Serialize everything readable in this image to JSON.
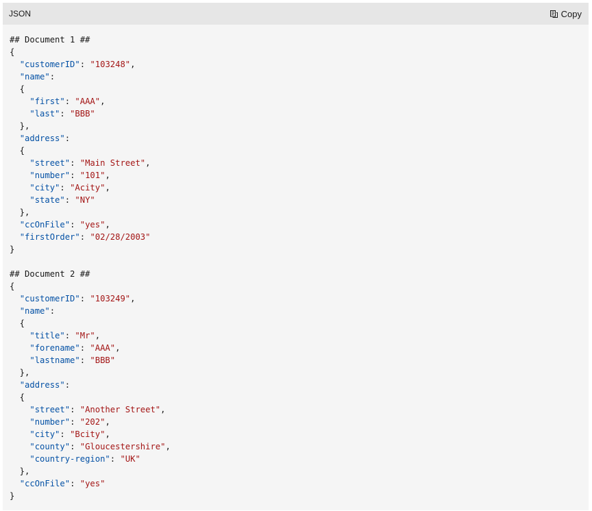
{
  "header": {
    "language": "JSON",
    "copy_label": "Copy",
    "copy_icon": "copy-icon"
  },
  "colors": {
    "key": "#0451a5",
    "string": "#a31515",
    "text": "#171717",
    "header_bg": "#e6e6e6",
    "body_bg": "#f5f5f5"
  },
  "code_lines": [
    [
      [
        "c",
        "## Document 1 ##"
      ]
    ],
    [
      [
        "p",
        "{"
      ]
    ],
    [
      [
        "p",
        "  "
      ],
      [
        "k",
        "\"customerID\""
      ],
      [
        "p",
        ": "
      ],
      [
        "s",
        "\"103248\""
      ],
      [
        "p",
        ","
      ]
    ],
    [
      [
        "p",
        "  "
      ],
      [
        "k",
        "\"name\""
      ],
      [
        "p",
        ":"
      ]
    ],
    [
      [
        "p",
        "  {"
      ]
    ],
    [
      [
        "p",
        "    "
      ],
      [
        "k",
        "\"first\""
      ],
      [
        "p",
        ": "
      ],
      [
        "s",
        "\"AAA\""
      ],
      [
        "p",
        ","
      ]
    ],
    [
      [
        "p",
        "    "
      ],
      [
        "k",
        "\"last\""
      ],
      [
        "p",
        ": "
      ],
      [
        "s",
        "\"BBB\""
      ]
    ],
    [
      [
        "p",
        "  },"
      ]
    ],
    [
      [
        "p",
        "  "
      ],
      [
        "k",
        "\"address\""
      ],
      [
        "p",
        ":"
      ]
    ],
    [
      [
        "p",
        "  {"
      ]
    ],
    [
      [
        "p",
        "    "
      ],
      [
        "k",
        "\"street\""
      ],
      [
        "p",
        ": "
      ],
      [
        "s",
        "\"Main Street\""
      ],
      [
        "p",
        ","
      ]
    ],
    [
      [
        "p",
        "    "
      ],
      [
        "k",
        "\"number\""
      ],
      [
        "p",
        ": "
      ],
      [
        "s",
        "\"101\""
      ],
      [
        "p",
        ","
      ]
    ],
    [
      [
        "p",
        "    "
      ],
      [
        "k",
        "\"city\""
      ],
      [
        "p",
        ": "
      ],
      [
        "s",
        "\"Acity\""
      ],
      [
        "p",
        ","
      ]
    ],
    [
      [
        "p",
        "    "
      ],
      [
        "k",
        "\"state\""
      ],
      [
        "p",
        ": "
      ],
      [
        "s",
        "\"NY\""
      ]
    ],
    [
      [
        "p",
        "  },"
      ]
    ],
    [
      [
        "p",
        "  "
      ],
      [
        "k",
        "\"ccOnFile\""
      ],
      [
        "p",
        ": "
      ],
      [
        "s",
        "\"yes\""
      ],
      [
        "p",
        ","
      ]
    ],
    [
      [
        "p",
        "  "
      ],
      [
        "k",
        "\"firstOrder\""
      ],
      [
        "p",
        ": "
      ],
      [
        "s",
        "\"02/28/2003\""
      ]
    ],
    [
      [
        "p",
        "}"
      ]
    ],
    [
      [
        "p",
        ""
      ]
    ],
    [
      [
        "c",
        "## Document 2 ##"
      ]
    ],
    [
      [
        "p",
        "{"
      ]
    ],
    [
      [
        "p",
        "  "
      ],
      [
        "k",
        "\"customerID\""
      ],
      [
        "p",
        ": "
      ],
      [
        "s",
        "\"103249\""
      ],
      [
        "p",
        ","
      ]
    ],
    [
      [
        "p",
        "  "
      ],
      [
        "k",
        "\"name\""
      ],
      [
        "p",
        ":"
      ]
    ],
    [
      [
        "p",
        "  {"
      ]
    ],
    [
      [
        "p",
        "    "
      ],
      [
        "k",
        "\"title\""
      ],
      [
        "p",
        ": "
      ],
      [
        "s",
        "\"Mr\""
      ],
      [
        "p",
        ","
      ]
    ],
    [
      [
        "p",
        "    "
      ],
      [
        "k",
        "\"forename\""
      ],
      [
        "p",
        ": "
      ],
      [
        "s",
        "\"AAA\""
      ],
      [
        "p",
        ","
      ]
    ],
    [
      [
        "p",
        "    "
      ],
      [
        "k",
        "\"lastname\""
      ],
      [
        "p",
        ": "
      ],
      [
        "s",
        "\"BBB\""
      ]
    ],
    [
      [
        "p",
        "  },"
      ]
    ],
    [
      [
        "p",
        "  "
      ],
      [
        "k",
        "\"address\""
      ],
      [
        "p",
        ":"
      ]
    ],
    [
      [
        "p",
        "  {"
      ]
    ],
    [
      [
        "p",
        "    "
      ],
      [
        "k",
        "\"street\""
      ],
      [
        "p",
        ": "
      ],
      [
        "s",
        "\"Another Street\""
      ],
      [
        "p",
        ","
      ]
    ],
    [
      [
        "p",
        "    "
      ],
      [
        "k",
        "\"number\""
      ],
      [
        "p",
        ": "
      ],
      [
        "s",
        "\"202\""
      ],
      [
        "p",
        ","
      ]
    ],
    [
      [
        "p",
        "    "
      ],
      [
        "k",
        "\"city\""
      ],
      [
        "p",
        ": "
      ],
      [
        "s",
        "\"Bcity\""
      ],
      [
        "p",
        ","
      ]
    ],
    [
      [
        "p",
        "    "
      ],
      [
        "k",
        "\"county\""
      ],
      [
        "p",
        ": "
      ],
      [
        "s",
        "\"Gloucestershire\""
      ],
      [
        "p",
        ","
      ]
    ],
    [
      [
        "p",
        "    "
      ],
      [
        "k",
        "\"country-region\""
      ],
      [
        "p",
        ": "
      ],
      [
        "s",
        "\"UK\""
      ]
    ],
    [
      [
        "p",
        "  },"
      ]
    ],
    [
      [
        "p",
        "  "
      ],
      [
        "k",
        "\"ccOnFile\""
      ],
      [
        "p",
        ": "
      ],
      [
        "s",
        "\"yes\""
      ]
    ],
    [
      [
        "p",
        "}"
      ]
    ]
  ]
}
